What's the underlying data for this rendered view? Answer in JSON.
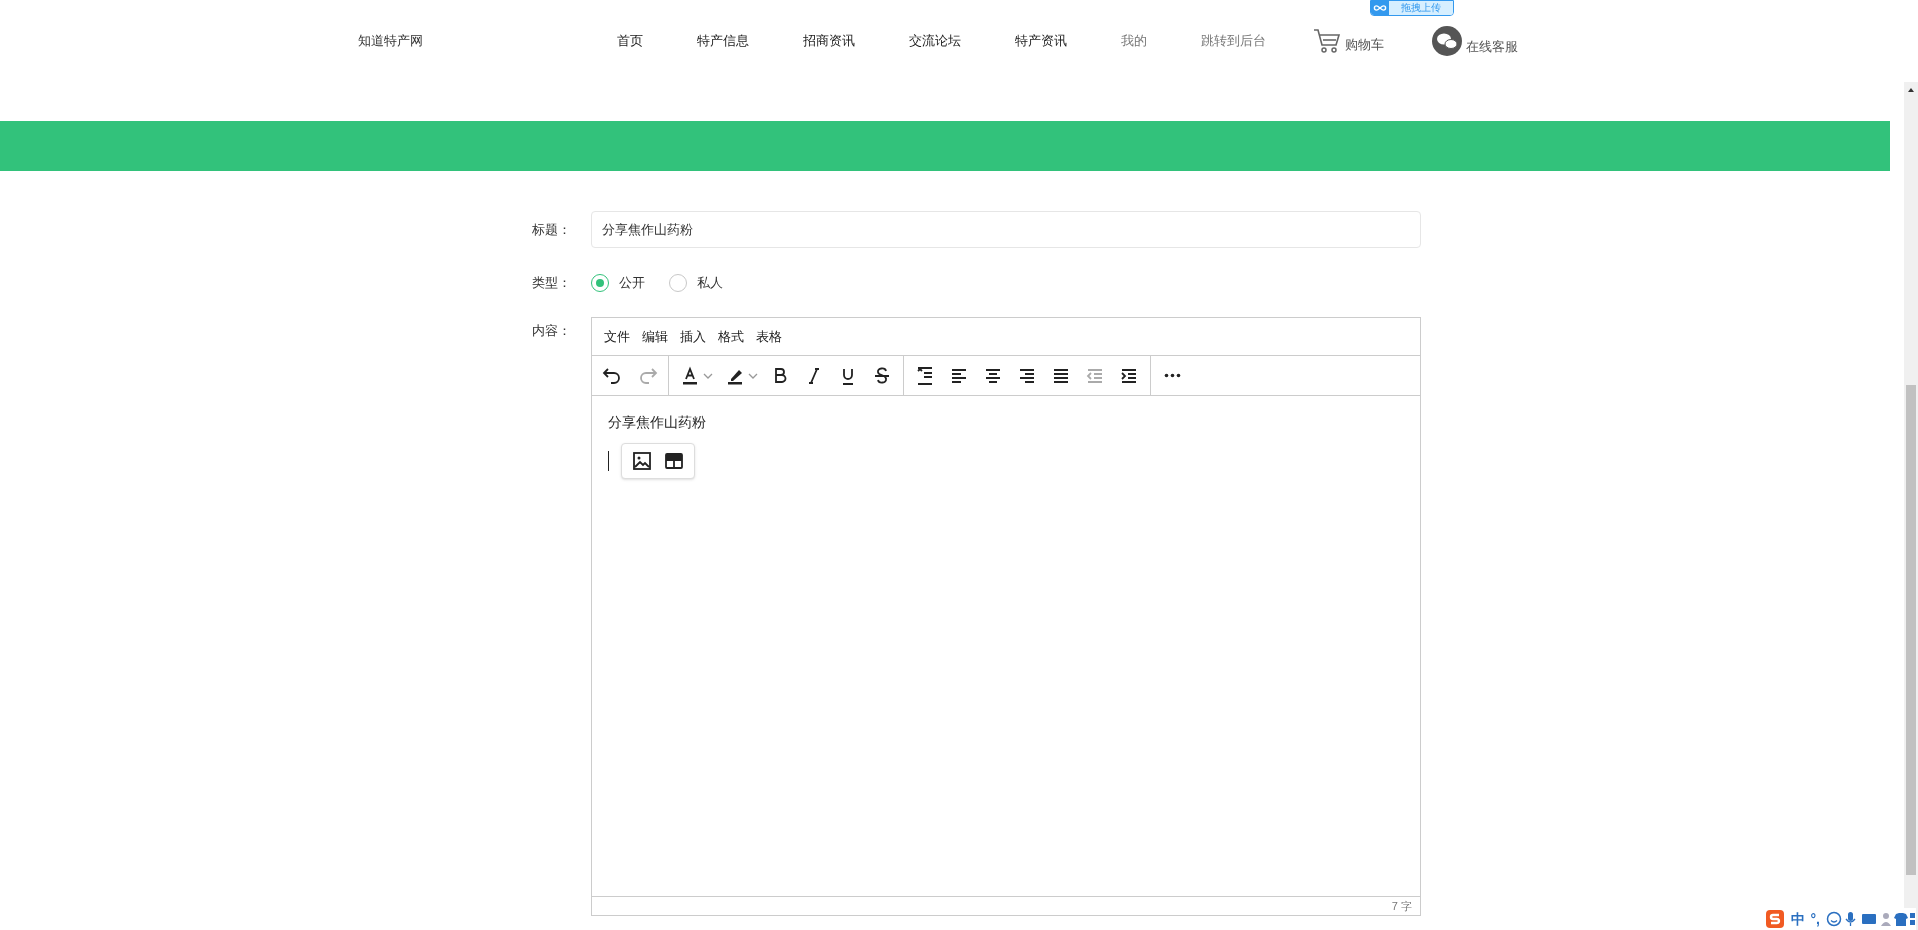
{
  "upload_widget": {
    "label": "拖拽上传"
  },
  "header": {
    "logo": "知道特产网",
    "nav": [
      {
        "label": "首页",
        "muted": false
      },
      {
        "label": "特产信息",
        "muted": false
      },
      {
        "label": "招商资讯",
        "muted": false
      },
      {
        "label": "交流论坛",
        "muted": false
      },
      {
        "label": "特产资讯",
        "muted": false
      },
      {
        "label": "我的",
        "muted": true
      },
      {
        "label": "跳转到后台",
        "muted": true
      }
    ],
    "cart": "购物车",
    "service": "在线客服"
  },
  "form": {
    "title_label": "标题：",
    "title_value": "分享焦作山药粉",
    "type_label": "类型：",
    "types": [
      {
        "label": "公开",
        "selected": true
      },
      {
        "label": "私人",
        "selected": false
      }
    ],
    "content_label": "内容："
  },
  "editor": {
    "menu": [
      "文件",
      "编辑",
      "插入",
      "格式",
      "表格"
    ],
    "toolbar": [
      [
        {
          "kind": "undo",
          "disabled": false
        },
        {
          "kind": "redo",
          "disabled": true
        }
      ],
      [
        {
          "kind": "forecolor",
          "disabled": false
        },
        {
          "kind": "hilitecolor",
          "disabled": false
        },
        {
          "kind": "bold",
          "disabled": false
        },
        {
          "kind": "italic",
          "disabled": false
        },
        {
          "kind": "underline",
          "disabled": false
        },
        {
          "kind": "strikethrough",
          "disabled": false
        }
      ],
      [
        {
          "kind": "lineheight",
          "disabled": false
        },
        {
          "kind": "alignleft",
          "disabled": false
        },
        {
          "kind": "aligncenter",
          "disabled": false
        },
        {
          "kind": "alignright",
          "disabled": false
        },
        {
          "kind": "alignjustify",
          "disabled": false
        },
        {
          "kind": "outdent",
          "disabled": true
        },
        {
          "kind": "indent",
          "disabled": false
        }
      ],
      [
        {
          "kind": "more",
          "disabled": false
        }
      ]
    ],
    "content": "分享焦作山药粉",
    "quick_insert": [
      {
        "kind": "image"
      },
      {
        "kind": "table"
      }
    ],
    "word_count": "7 字"
  },
  "ime": {
    "items": [
      "中",
      "°,"
    ]
  }
}
